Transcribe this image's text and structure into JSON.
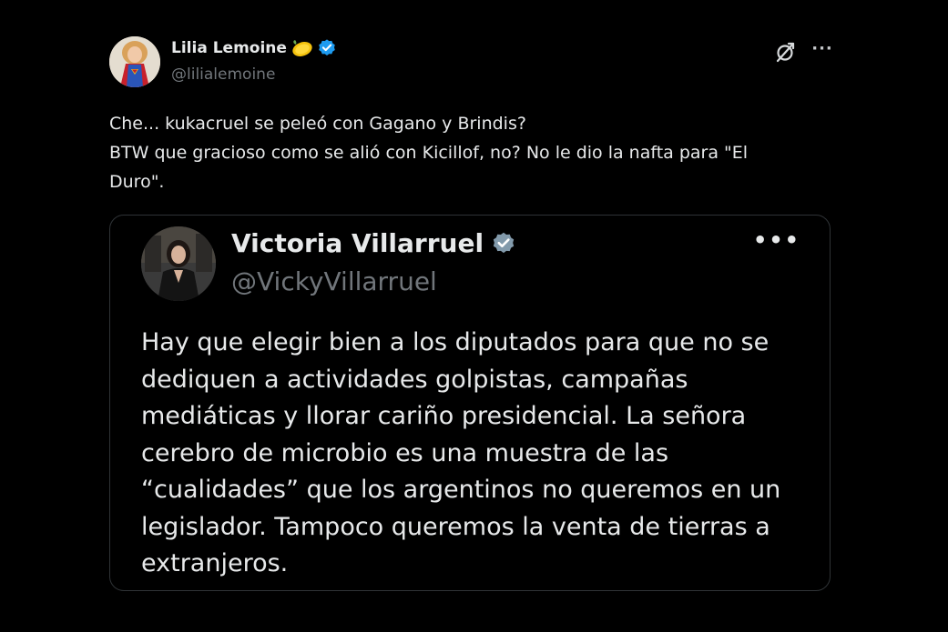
{
  "tweet": {
    "author": {
      "name": "Lilia Lemoine",
      "handle": "@lilialemoine",
      "emoji_icon": "lemon-emoji",
      "verified_icon": "verified-badge-icon",
      "verified_color": "#1d9bf0"
    },
    "text_lines": [
      "Che... kukacruel se peleó con Gagano y Brindis?",
      "BTW que gracioso como se alió con Kicillof, no? No le dio la nafta para \"El",
      "Duro\"."
    ],
    "actions": {
      "grok_icon": "grok-icon",
      "more_label": "···"
    }
  },
  "quoted_tweet": {
    "author": {
      "name": "Victoria Villarruel",
      "handle": "@VickyVillarruel",
      "verified_icon": "verified-gray-badge-icon",
      "verified_color": "#829aab"
    },
    "more_label": "•••",
    "text_lines": [
      "Hay que elegir bien a los diputados para que no se",
      "dediquen a actividades golpistas, campañas",
      "mediáticas y llorar cariño presidencial. La señora",
      "cerebro de microbio es una muestra de las",
      "“cualidades” que los argentinos no queremos en un",
      "legislador. Tampoco queremos la venta de tierras a",
      "extranjeros."
    ]
  },
  "colors": {
    "background": "#000000",
    "text_primary": "#e7e9ea",
    "text_secondary": "#71767b",
    "card_border": "#2f3336"
  }
}
